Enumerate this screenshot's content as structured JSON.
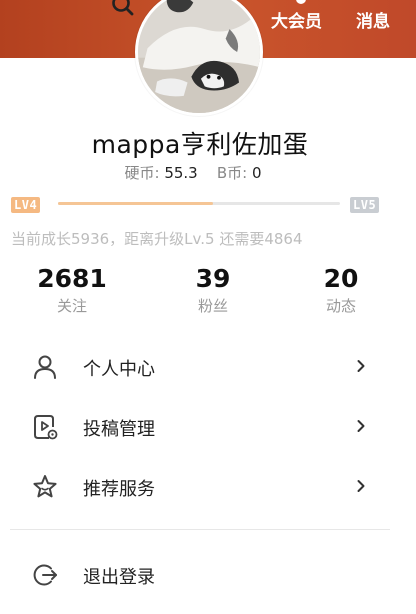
{
  "header": {
    "vip_label": "大会员",
    "messages_label": "消息",
    "search_icon": "search-icon",
    "brand_color": "#c04a28"
  },
  "profile": {
    "username": "mappa亨利佐加蛋",
    "hard_coin_label": "硬币:",
    "hard_coin_value": "55.3",
    "b_coin_label": "B币:",
    "b_coin_value": "0"
  },
  "level": {
    "current": "LV4",
    "next": "LV5",
    "progress": 0.55,
    "hint": "当前成长5936，距离升级Lv.5 还需要4864"
  },
  "stats": [
    {
      "value": "2681",
      "label": "关注"
    },
    {
      "value": "39",
      "label": "粉丝"
    },
    {
      "value": "20",
      "label": "动态"
    }
  ],
  "menu": {
    "personal_center": "个人中心",
    "submission_management": "投稿管理",
    "recommended_services": "推荐服务",
    "logout": "退出登录"
  }
}
